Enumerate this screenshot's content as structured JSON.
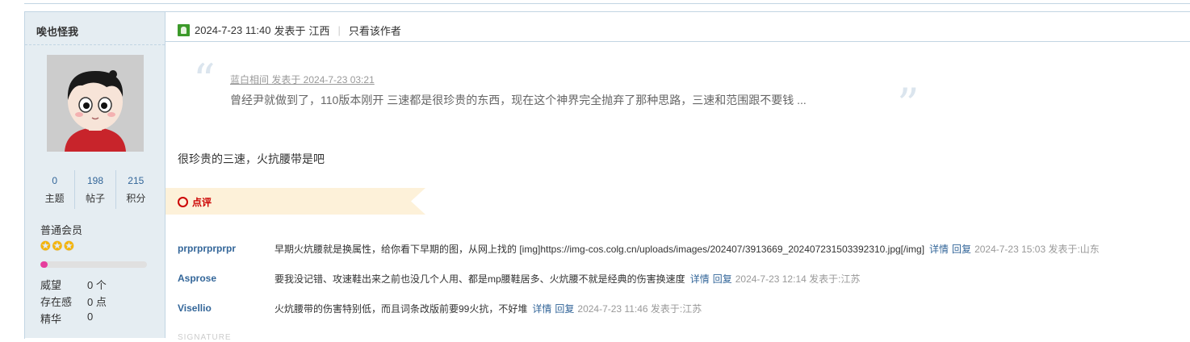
{
  "user": {
    "name": "唉也怪我",
    "stats": [
      {
        "num": "0",
        "label": "主题"
      },
      {
        "num": "198",
        "label": "帖子"
      },
      {
        "num": "215",
        "label": "积分"
      }
    ],
    "group": "普通会员",
    "stars": 3,
    "progress_fraction": 0.07,
    "info": [
      {
        "key": "威望",
        "value": "0 个"
      },
      {
        "key": "存在感",
        "value": "0 点"
      },
      {
        "key": "精华",
        "value": "0"
      }
    ]
  },
  "post": {
    "time": "2024-7-23 11:40",
    "posted_at": "发表于",
    "location": "江西",
    "separator": "|",
    "only_author": "只看该作者",
    "quote": {
      "header": "蓝白相间 发表于 2024-7-23 03:21",
      "body": "曾经尹就做到了，110版本刚开 三速都是很珍贵的东西，现在这个神界完全抛弃了那种思路，三速和范围跟不要钱 ..."
    },
    "reply": "很珍贵的三速，火抗腰带是吧",
    "comment_label": "点评",
    "signature": "SIGNATURE"
  },
  "comments": [
    {
      "user": "prprprprprpr",
      "text": "早期火炕腰就是换属性，给你看下早期的图，从网上找的 [img]https://img-cos.colg.cn/uploads/images/202407/3913669_202407231503392310.jpg[/img]",
      "detail": "详情",
      "reply": "回复",
      "time": "2024-7-23 15:03 发表于:山东"
    },
    {
      "user": "Asprose",
      "text": "要我没记错、攻速鞋出来之前也没几个人用、都是mp腰鞋居多、火炕腰不就是经典的伤害换速度",
      "detail": "详情",
      "reply": "回复",
      "time": "2024-7-23 12:14 发表于:江苏"
    },
    {
      "user": "Visellio",
      "text": "火炕腰带的伤害特别低，而且词条改版前要99火抗，不好堆",
      "detail": "详情",
      "reply": "回复",
      "time": "2024-7-23 11:46 发表于:江苏"
    }
  ],
  "colors": {
    "accent": "#336699",
    "sidebar_bg": "#e5edf2",
    "border": "#c2d5e3",
    "comment_banner": "#fdf1d9",
    "progress": "#e63d9d"
  }
}
